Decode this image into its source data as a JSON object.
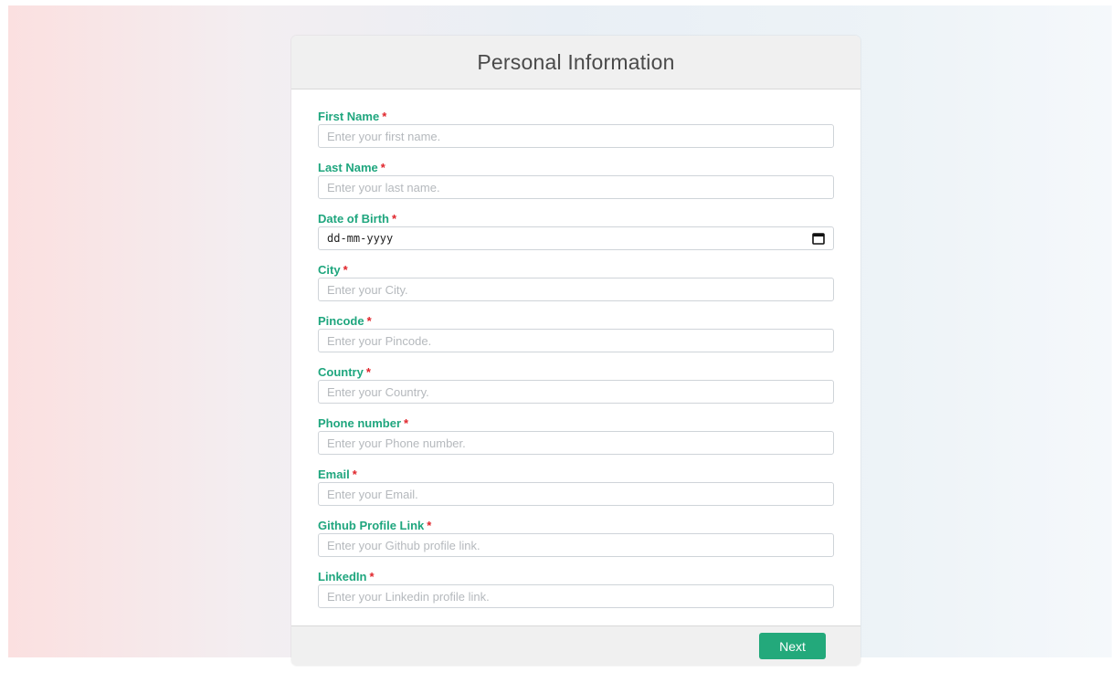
{
  "form": {
    "title": "Personal Information",
    "fields": [
      {
        "label": "First Name",
        "required": "*",
        "placeholder": "Enter your first name."
      },
      {
        "label": "Last Name",
        "required": "*",
        "placeholder": "Enter your last name."
      },
      {
        "label": "Date of Birth",
        "required": "*",
        "value": "dd-mm-yyyy",
        "icon": "calendar-icon"
      },
      {
        "label": "City",
        "required": "*",
        "placeholder": "Enter your City."
      },
      {
        "label": "Pincode",
        "required": "*",
        "placeholder": "Enter your Pincode."
      },
      {
        "label": "Country",
        "required": "*",
        "placeholder": "Enter your Country."
      },
      {
        "label": "Phone number",
        "required": "*",
        "placeholder": "Enter your Phone number."
      },
      {
        "label": "Email",
        "required": "*",
        "placeholder": "Enter your Email."
      },
      {
        "label": "Github Profile Link",
        "required": "*",
        "placeholder": "Enter your Github profile link."
      },
      {
        "label": "LinkedIn",
        "required": "*",
        "placeholder": "Enter your Linkedin profile link."
      }
    ],
    "next_label": "Next"
  },
  "colors": {
    "label": "#1fa67e",
    "required": "#e0242a",
    "button": "#23a97b"
  }
}
